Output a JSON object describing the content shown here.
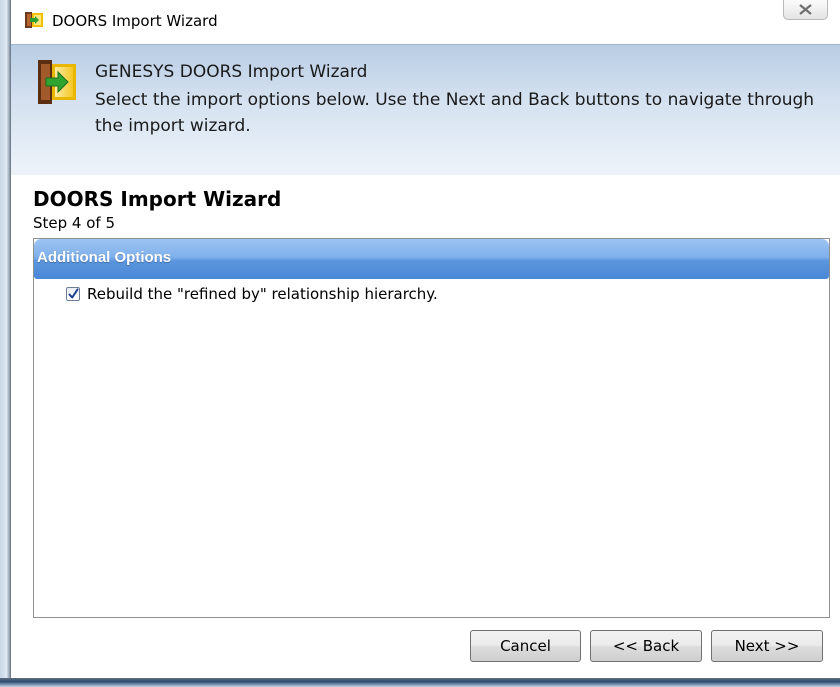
{
  "window": {
    "title": "DOORS Import Wizard",
    "close_glyph": "✕"
  },
  "banner": {
    "heading": "GENESYS DOORS Import Wizard",
    "description": "Select the import options below.  Use the Next and Back buttons to navigate through the import wizard.",
    "icon": "door-import-icon"
  },
  "wizard": {
    "title": "DOORS Import Wizard",
    "step": "Step 4 of 5"
  },
  "panel": {
    "header": "Additional Options",
    "options": [
      {
        "label": "Rebuild the \"refined by\" relationship hierarchy.",
        "checked": true
      }
    ]
  },
  "buttons": {
    "cancel": "Cancel",
    "back": "<< Back",
    "next": "Next >>"
  },
  "colors": {
    "panel_header": "#5b95de",
    "banner": "#d3e0ef"
  }
}
